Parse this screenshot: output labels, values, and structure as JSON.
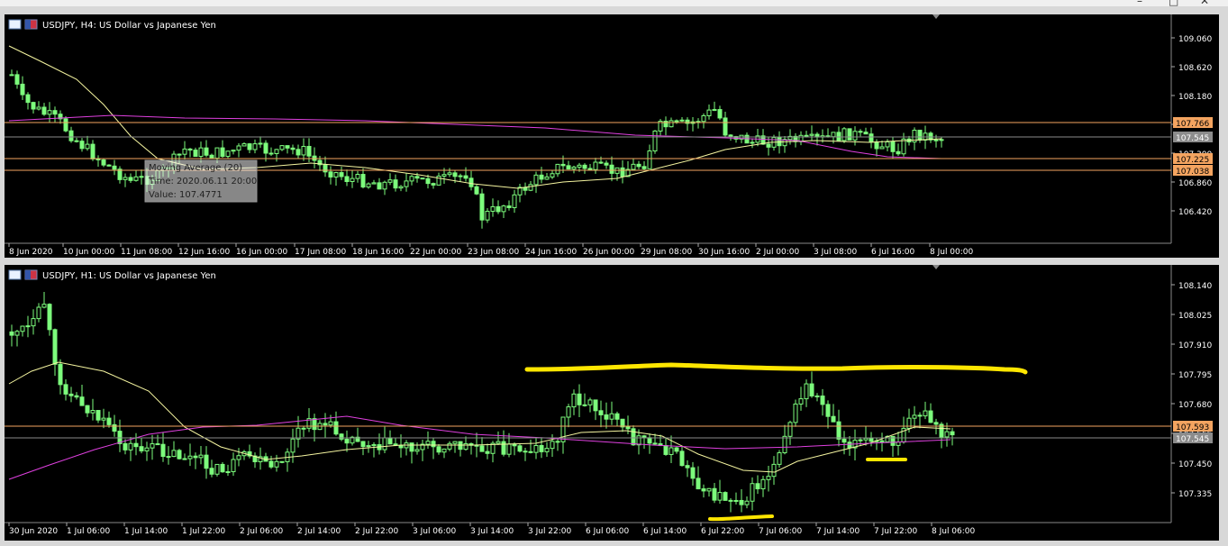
{
  "window": {
    "minimize": "–",
    "maximize": "□",
    "close": "✕"
  },
  "charts": [
    {
      "id": "h4",
      "header": "USDJPY, H4:  US Dollar vs Japanese Yen",
      "y_ticks": [
        "109.060",
        "108.620",
        "108.180",
        "107.740",
        "107.300",
        "106.860",
        "106.420"
      ],
      "x_ticks": [
        "8 Jun 2020",
        "10 Jun 00:00",
        "11 Jun 08:00",
        "12 Jun 16:00",
        "16 Jun 00:00",
        "17 Jun 08:00",
        "18 Jun 16:00",
        "22 Jun 00:00",
        "23 Jun 08:00",
        "24 Jun 16:00",
        "26 Jun 00:00",
        "29 Jun 08:00",
        "30 Jun 16:00",
        "2 Jul 00:00",
        "3 Jul 08:00",
        "6 Jul 16:00",
        "8 Jul 00:00"
      ],
      "price_tags": [
        {
          "label": "107.766",
          "kind": "orange"
        },
        {
          "label": "107.545",
          "kind": "gray"
        },
        {
          "label": "107.225",
          "kind": "orange"
        },
        {
          "label": "107.038",
          "kind": "orange"
        }
      ],
      "tooltip": [
        "Moving Average (20)",
        "Time: 2020.06.11 20:00",
        "Value: 107.4771"
      ]
    },
    {
      "id": "h1",
      "header": "USDJPY, H1:  US Dollar vs Japanese Yen",
      "y_ticks": [
        "108.140",
        "108.025",
        "107.910",
        "107.795",
        "107.680",
        "107.565",
        "107.450",
        "107.335"
      ],
      "x_ticks": [
        "30 Jun 2020",
        "1 Jul 06:00",
        "1 Jul 14:00",
        "1 Jul 22:00",
        "2 Jul 06:00",
        "2 Jul 14:00",
        "2 Jul 22:00",
        "3 Jul 06:00",
        "3 Jul 14:00",
        "3 Jul 22:00",
        "6 Jul 06:00",
        "6 Jul 14:00",
        "6 Jul 22:00",
        "7 Jul 06:00",
        "7 Jul 14:00",
        "7 Jul 22:00",
        "8 Jul 06:00"
      ],
      "price_tags": [
        {
          "label": "107.593",
          "kind": "orange"
        },
        {
          "label": "107.545",
          "kind": "gray"
        }
      ]
    }
  ],
  "colors": {
    "candle": "#7cfc7c",
    "ma_fast": "#f5f5a0",
    "ma_slow": "#e040e0",
    "level": "#f4a460",
    "bid": "#8a8a8a",
    "grid_text": "#ffffff",
    "annotation": "#ffe600"
  }
}
